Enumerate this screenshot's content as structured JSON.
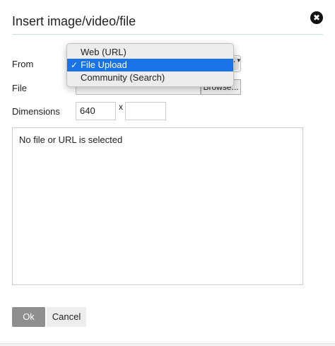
{
  "dialog": {
    "title": "Insert image/video/file",
    "close_glyph": "✖"
  },
  "form": {
    "from_label": "From",
    "file_label": "File",
    "dimensions_label": "Dimensions",
    "browse_label": "Browse...",
    "width_value": "640",
    "height_value": "",
    "separator": "x",
    "select_arrows": "▲▼"
  },
  "dropdown": {
    "items": [
      {
        "label": "Web (URL)",
        "selected": false
      },
      {
        "label": "File Upload",
        "selected": true
      },
      {
        "label": "Community (Search)",
        "selected": false
      }
    ],
    "check_glyph": "✓"
  },
  "preview": {
    "message": "No file or URL is selected"
  },
  "buttons": {
    "ok": "Ok",
    "cancel": "Cancel"
  },
  "colors": {
    "accent": "#1a72e8",
    "ok_button": "#8f8f8f"
  }
}
